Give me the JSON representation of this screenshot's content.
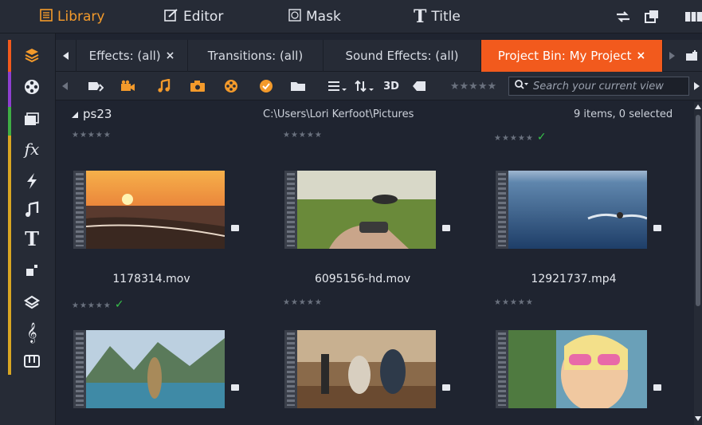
{
  "menu": {
    "library": "Library",
    "editor": "Editor",
    "mask": "Mask",
    "title": "Title"
  },
  "tabs": [
    {
      "label": "Effects: (all)",
      "close": "×"
    },
    {
      "label": "Transitions: (all)"
    },
    {
      "label": "Sound Effects: (all)"
    },
    {
      "label": "Project Bin: My Project",
      "close": "×"
    }
  ],
  "toolbar": {
    "label_3d": "3D",
    "search_placeholder": "Search your current view"
  },
  "folder": {
    "name": "ps23",
    "path": "C:\\Users\\Lori Kerfoot\\Pictures",
    "count": "9 items, 0 selected"
  },
  "items": [
    {
      "caption": "1178314.mov"
    },
    {
      "caption": "6095156-hd.mov"
    },
    {
      "caption": "12921737.mp4"
    },
    {
      "caption": ""
    },
    {
      "caption": ""
    },
    {
      "caption": ""
    }
  ],
  "colors": {
    "accent": "#f39a2b",
    "active_tab": "#f25a1d",
    "check": "#37c24a"
  }
}
